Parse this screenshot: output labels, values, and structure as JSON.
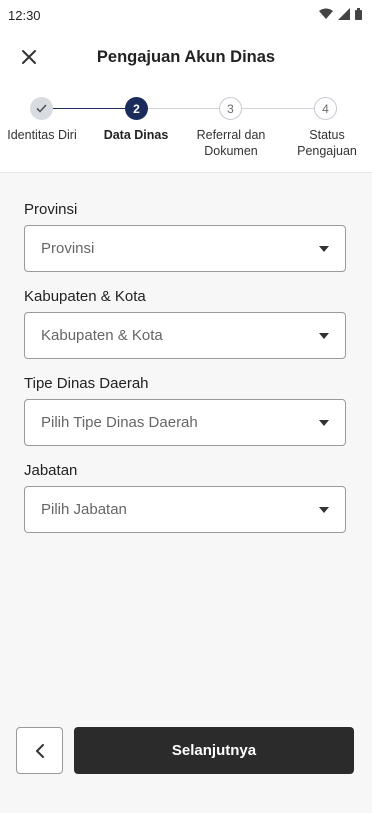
{
  "status_bar": {
    "time": "12:30"
  },
  "header": {
    "title": "Pengajuan Akun Dinas"
  },
  "stepper": {
    "steps": [
      {
        "number": "1",
        "label": "Identitas Diri",
        "state": "done"
      },
      {
        "number": "2",
        "label": "Data Dinas",
        "state": "active"
      },
      {
        "number": "3",
        "label_line1": "Referral dan",
        "label_line2": "Dokumen",
        "state": "pending"
      },
      {
        "number": "4",
        "label_line1": "Status",
        "label_line2": "Pengajuan",
        "state": "pending"
      }
    ]
  },
  "form": {
    "fields": [
      {
        "label": "Provinsi",
        "placeholder": "Provinsi"
      },
      {
        "label": "Kabupaten & Kota",
        "placeholder": "Kabupaten & Kota"
      },
      {
        "label": "Tipe Dinas Daerah",
        "placeholder": "Pilih Tipe Dinas Daerah"
      },
      {
        "label": "Jabatan",
        "placeholder": "Pilih Jabatan"
      }
    ]
  },
  "footer": {
    "next_label": "Selanjutnya"
  },
  "colors": {
    "primary": "#1a2b5c",
    "button_dark": "#2b2b2b",
    "form_bg": "#f7f7f7"
  }
}
